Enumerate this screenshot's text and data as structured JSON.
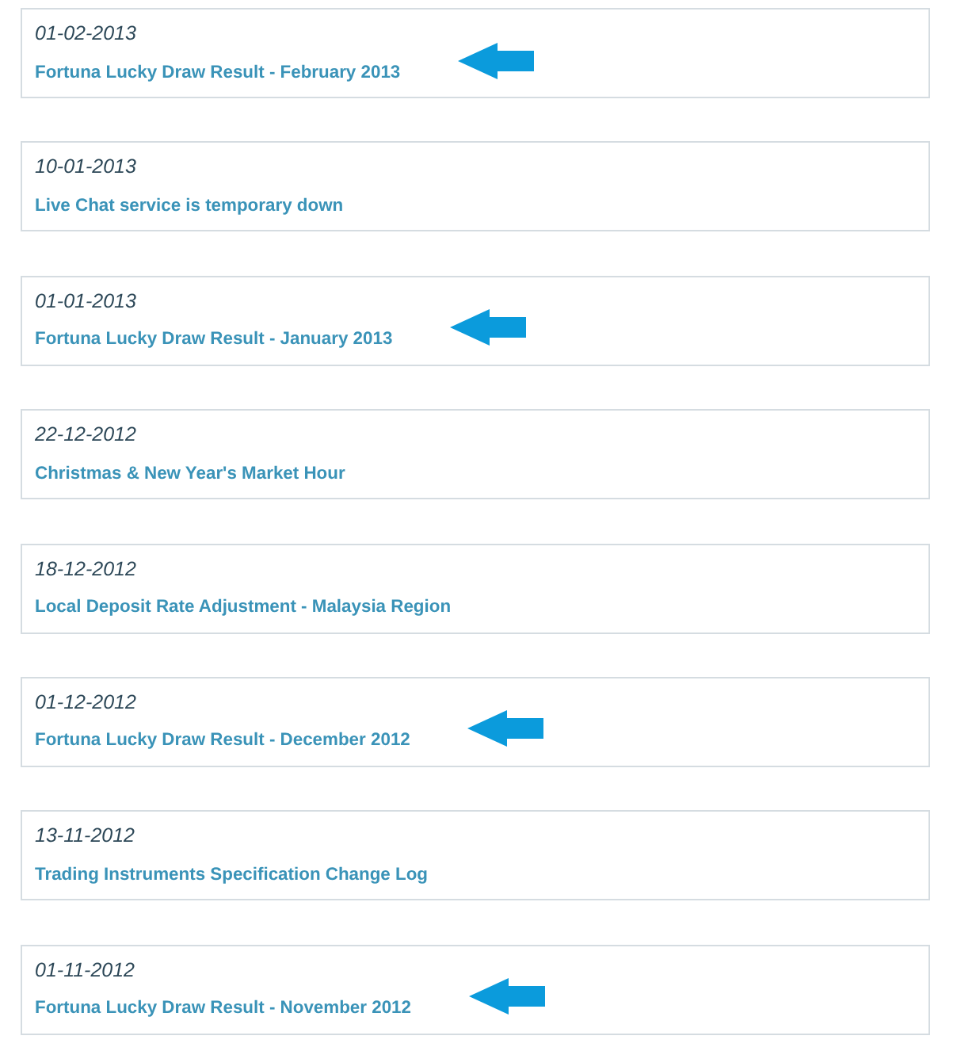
{
  "items": [
    {
      "date": "01-02-2013",
      "title": "Fortuna Lucky Draw Result - February 2013",
      "arrow": true
    },
    {
      "date": "10-01-2013",
      "title": "Live Chat service is temporary down",
      "arrow": false
    },
    {
      "date": "01-01-2013",
      "title": "Fortuna Lucky Draw Result - January 2013",
      "arrow": true
    },
    {
      "date": "22-12-2012",
      "title": "Christmas & New Year's Market Hour",
      "arrow": false
    },
    {
      "date": "18-12-2012",
      "title": "Local Deposit Rate Adjustment - Malaysia Region",
      "arrow": false
    },
    {
      "date": "01-12-2012",
      "title": "Fortuna Lucky Draw Result - December 2012",
      "arrow": true
    },
    {
      "date": "13-11-2012",
      "title": "Trading Instruments Specification Change Log",
      "arrow": false
    },
    {
      "date": "01-11-2012",
      "title": "Fortuna Lucky Draw Result - November 2012",
      "arrow": true
    }
  ]
}
